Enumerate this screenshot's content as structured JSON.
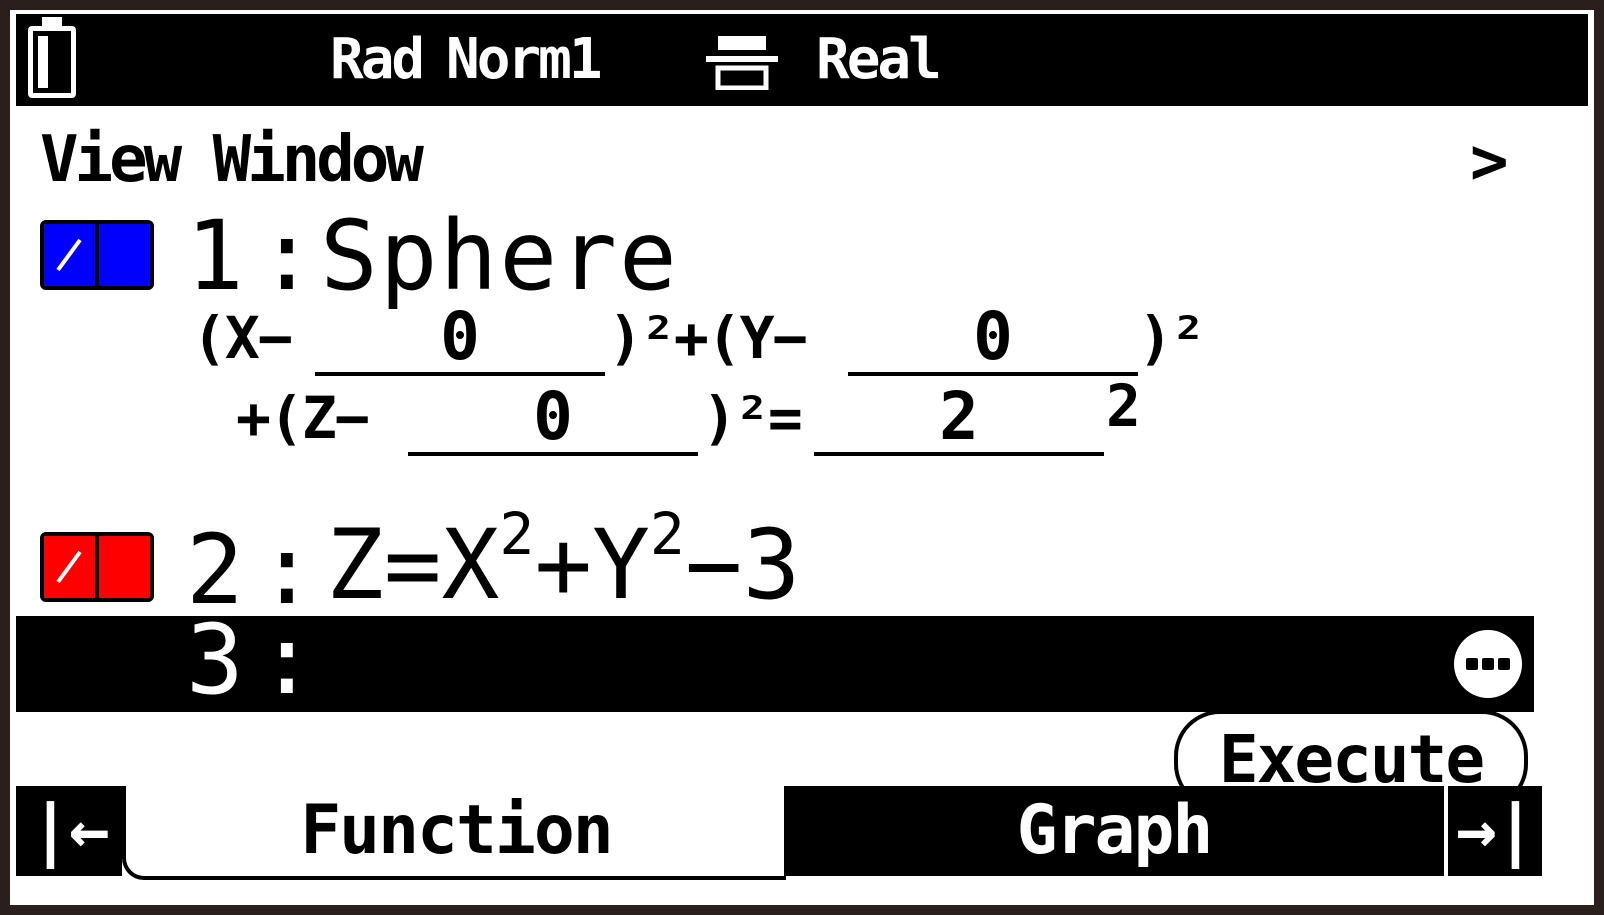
{
  "status_bar": {
    "angle_mode": "Rad",
    "display_format": "Norm1",
    "complex_mode": "Real",
    "battery_icon": "battery-icon",
    "display_icon": "input-output-icon"
  },
  "screen_title": "View Window",
  "title_chevron": ">",
  "functions": [
    {
      "number": "1",
      "colon": ":",
      "name": "Sphere",
      "color": "#0000ff"
    },
    {
      "number": "2",
      "colon": ":",
      "color": "#ff0000",
      "expr": {
        "a": "Z=X",
        "sup1": "2",
        "b": "+Y",
        "sup2": "2",
        "c": "−3"
      }
    },
    {
      "number": "3",
      "colon": ":"
    }
  ],
  "sphere_equation": {
    "x_open": "(X−",
    "x_value": "0",
    "x_close": ")²+(Y−",
    "y_value": "0",
    "y_close": ")²",
    "z_open": "+(Z−",
    "z_value": "0",
    "z_close": ")²=",
    "radius": "2",
    "radius_sup": "2"
  },
  "execute_label": "Execute",
  "tabs": {
    "prev": "|←",
    "function": "Function",
    "graph": "Graph",
    "next": "→|"
  }
}
